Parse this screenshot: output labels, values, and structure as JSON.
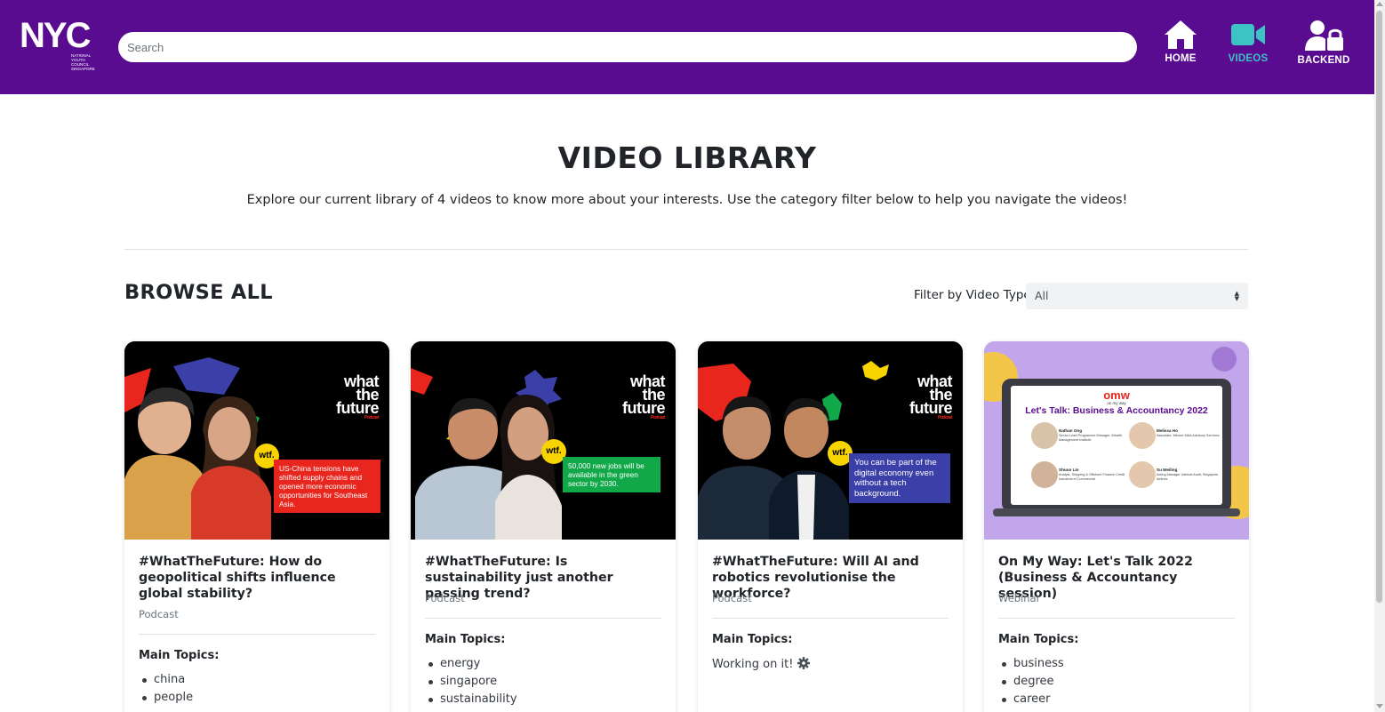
{
  "app": {
    "logo_text": "NYC",
    "logo_subtext": [
      "National",
      "Youth",
      "Council",
      "Singapore"
    ]
  },
  "header": {
    "search_placeholder": "Search",
    "nav": [
      {
        "label": "HOME",
        "icon": "home-icon"
      },
      {
        "label": "VIDEOS",
        "icon": "video-camera-icon",
        "active": true
      },
      {
        "label": "BACKEND",
        "icon": "user-lock-icon"
      }
    ]
  },
  "colors": {
    "header_bg": "#5a0c91",
    "active_nav": "#3cc4c4",
    "wtf_red": "#e8261d",
    "wtf_green": "#11a84a",
    "wtf_blue": "#3b3fa8",
    "wtf_yellow": "#f7d300"
  },
  "main": {
    "title": "VIDEO LIBRARY",
    "lead": "Explore our current library of 4 videos to know more about your interests. Use the category filter below to help you navigate the videos!",
    "browse_title": "BROWSE ALL",
    "filter_label": "Filter by Video Type:",
    "filter_value": "All"
  },
  "cards": [
    {
      "title": "#WhatTheFuture: How do geopolitical shifts influence global stability?",
      "type": "Podcast",
      "topics_label": "Main Topics:",
      "topics": [
        "china",
        "people"
      ],
      "thumb": {
        "brand_lines": [
          "what",
          "the",
          "future"
        ],
        "brand_tag": "Podcast",
        "badge": "wtf.",
        "callout": "US-China tensions have shifted supply chains and opened more economic opportunities for Southeast Asia."
      }
    },
    {
      "title": "#WhatTheFuture: Is sustainability just another passing trend?",
      "type": "Podcast",
      "topics_label": "Main Topics:",
      "topics": [
        "energy",
        "singapore",
        "sustainability"
      ],
      "thumb": {
        "brand_lines": [
          "what",
          "the",
          "future"
        ],
        "brand_tag": "Podcast",
        "badge": "wtf.",
        "callout": "50,000 new jobs will be available in the green sector by 2030."
      }
    },
    {
      "title": "#WhatTheFuture: Will AI and robotics revolutionise the workforce?",
      "type": "Podcast",
      "topics_label": "Main Topics:",
      "working_text": "Working on it!",
      "thumb": {
        "brand_lines": [
          "what",
          "the",
          "future"
        ],
        "brand_tag": "Podcast",
        "badge": "wtf.",
        "callout": "You can be part of the digital economy even without a tech background."
      }
    },
    {
      "title": "On My Way: Let's Talk 2022 (Business & Accountancy session)",
      "type": "Webinar",
      "topics_label": "Main Topics:",
      "topics": [
        "business",
        "degree",
        "career"
      ],
      "thumb": {
        "logo": "omw",
        "logo_sub": "on my way",
        "heading": "Let's Talk: Business & Accountancy 2022",
        "speakers": [
          {
            "name": "Nathan Ong",
            "role": "Senior Lead Programme Manager, Wealth Management Institute"
          },
          {
            "name": "Melissa Ho",
            "role": "Associate, Mercer M&A Advisory Services"
          },
          {
            "name": "Shuon Lin",
            "role": "Analyst, Shipping & Offshore Finance Credit Industrial et Commercial"
          },
          {
            "name": "Su Weiling",
            "role": "Acting Manager Internal Audit, Singapore Airlines"
          }
        ]
      }
    }
  ]
}
